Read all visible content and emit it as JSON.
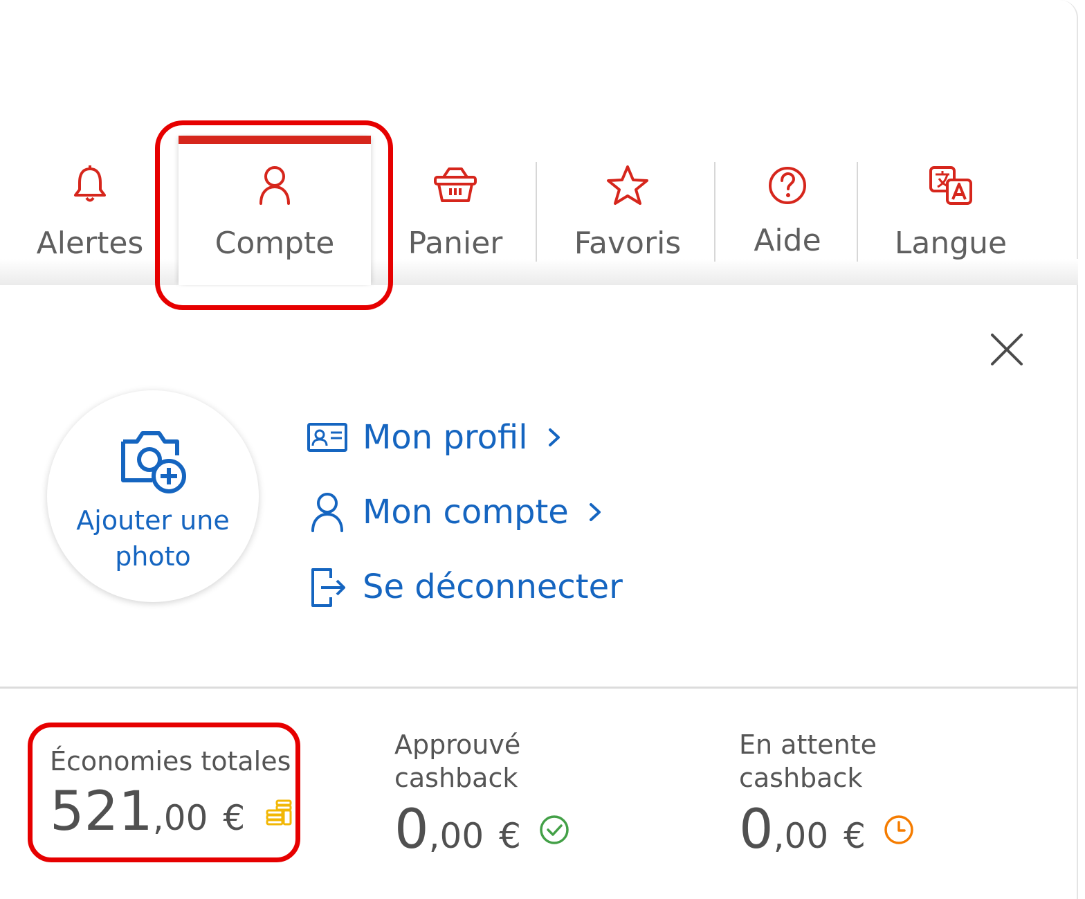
{
  "nav": {
    "items": [
      {
        "label": "Alertes",
        "icon": "bell-icon"
      },
      {
        "label": "Compte",
        "icon": "user-icon",
        "active": true
      },
      {
        "label": "Panier",
        "icon": "basket-icon"
      },
      {
        "label": "Favoris",
        "icon": "star-icon"
      },
      {
        "label": "Aide",
        "icon": "help-circle-icon"
      },
      {
        "label": "Langue",
        "icon": "translate-icon"
      }
    ],
    "accent_color": "#d6261c"
  },
  "account_menu": {
    "add_photo_label": "Ajouter une photo",
    "links": [
      {
        "label": "Mon profil",
        "icon": "id-card-icon"
      },
      {
        "label": "Mon compte",
        "icon": "user-icon"
      },
      {
        "label": "Se déconnecter",
        "icon": "logout-icon"
      }
    ],
    "link_color": "#1565c0"
  },
  "stats": {
    "total": {
      "label": "Économies totales",
      "whole": "521",
      "decimal": ",00",
      "currency": "€",
      "icon": "coins-icon",
      "icon_color": "#f2b705"
    },
    "approved": {
      "label_line1": "Approuvé",
      "label_line2": "cashback",
      "whole": "0",
      "decimal": ",00",
      "currency": "€",
      "icon": "check-circle-icon",
      "icon_color": "#43a047"
    },
    "pending": {
      "label_line1": "En attente",
      "label_line2": "cashback",
      "whole": "0",
      "decimal": ",00",
      "currency": "€",
      "icon": "clock-icon",
      "icon_color": "#f57c00"
    }
  },
  "highlight_color": "#e60000"
}
